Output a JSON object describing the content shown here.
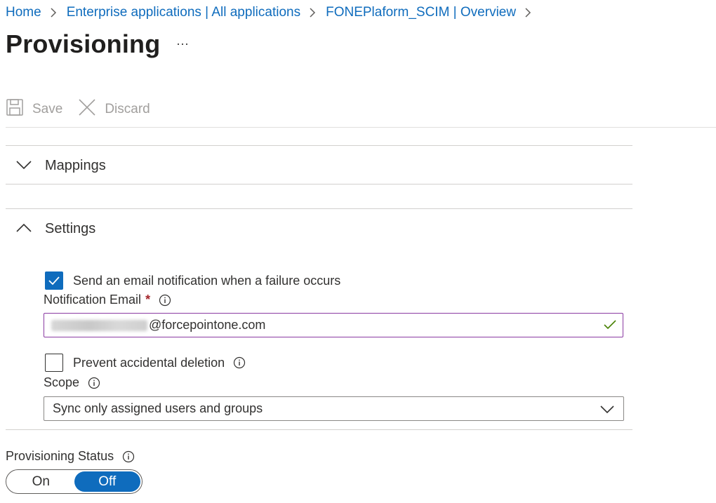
{
  "breadcrumb": {
    "items": [
      "Home",
      "Enterprise applications | All applications",
      "FONEPlaform_SCIM | Overview"
    ]
  },
  "page": {
    "title": "Provisioning",
    "more": "···"
  },
  "toolbar": {
    "save_label": "Save",
    "discard_label": "Discard"
  },
  "sections": {
    "mappings": {
      "label": "Mappings",
      "expanded": false
    },
    "settings": {
      "label": "Settings",
      "expanded": true
    }
  },
  "settings": {
    "email_notification": {
      "label": "Send an email notification when a failure occurs",
      "checked": true
    },
    "notification_email": {
      "label": "Notification Email",
      "required_mark": "*",
      "value_domain": "@forcepointone.com"
    },
    "prevent_deletion": {
      "label": "Prevent accidental deletion",
      "checked": false
    },
    "scope": {
      "label": "Scope",
      "selected": "Sync only assigned users and groups"
    }
  },
  "provisioning_status": {
    "label": "Provisioning Status",
    "on_label": "On",
    "off_label": "Off",
    "selected": "Off"
  },
  "colors": {
    "accent": "#0f6cbd",
    "input_focus_border": "#8a3aa2",
    "valid_check": "#498205",
    "required": "#a4262c"
  }
}
